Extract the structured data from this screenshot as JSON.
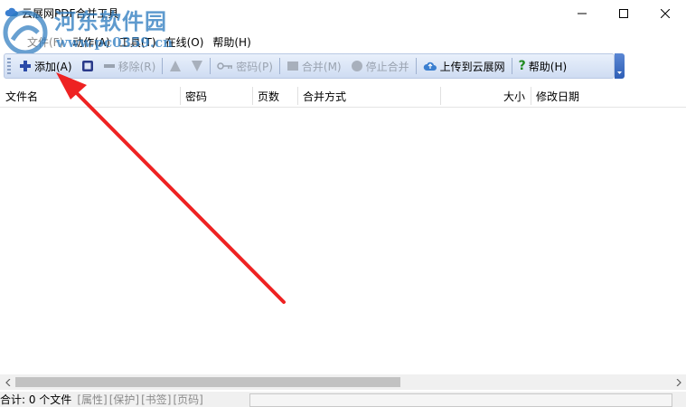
{
  "window": {
    "title": "云展网PDF合并工具",
    "controls": {
      "minimize": "minimize",
      "maximize": "maximize",
      "close": "close"
    }
  },
  "watermark": {
    "text": "河东软件园",
    "url": "www.pc0359.cn"
  },
  "menu": [
    "文件(F)",
    "动作(A)",
    "工具(T)",
    "在线(O)",
    "帮助(H)"
  ],
  "toolbar": {
    "add": "添加(A)",
    "remove": "移除(R)",
    "password": "密码(P)",
    "merge": "合并(M)",
    "stop": "停止合并",
    "upload": "上传到云展网",
    "help": "帮助(H)"
  },
  "columns": [
    "文件名",
    "密码",
    "页数",
    "合并方式",
    "大小",
    "修改日期"
  ],
  "status": {
    "total": "合计: 0 个文件",
    "panels": [
      "[属性]",
      "[保护]",
      "[书签]",
      "[页码]"
    ]
  },
  "colors": {
    "accent": "#2f5fb6",
    "annotation": "#ee2222"
  }
}
